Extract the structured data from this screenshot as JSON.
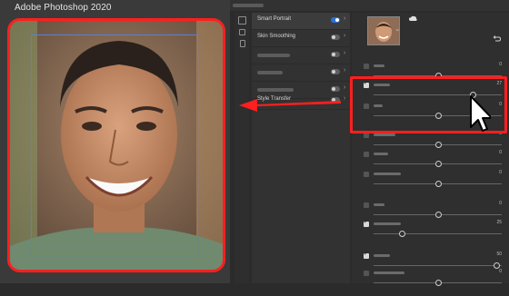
{
  "app": {
    "title": "Adobe Photoshop 2020"
  },
  "colors": {
    "highlight": "#ff1f1f",
    "accent": "#2e6fd8",
    "tracker": "#5b7fd6"
  },
  "filters": {
    "items": [
      {
        "label": "Smart Portrait",
        "enabled": true,
        "active": true
      },
      {
        "label": "Skin Smoothing",
        "enabled": false
      },
      {
        "label": "",
        "enabled": false
      },
      {
        "label": "",
        "enabled": false
      },
      {
        "label": "",
        "enabled": false
      },
      {
        "label": "Style Transfer",
        "enabled": false
      }
    ]
  },
  "icons": {
    "cloud": "cloud-icon",
    "undo": "reset-icon",
    "cursor": "mouse-pointer-icon",
    "arrow": "red-arrow-icon"
  },
  "sliders": [
    {
      "checked": false,
      "value": "0",
      "level": 0.5
    },
    {
      "checked": true,
      "value": "27",
      "level": 0.77
    },
    {
      "checked": false,
      "value": "0",
      "level": 0.5
    },
    {
      "checked": false,
      "value": "0",
      "level": 0.5
    },
    {
      "checked": false,
      "value": "0",
      "level": 0.5
    },
    {
      "checked": false,
      "value": "0",
      "level": 0.5
    },
    {
      "checked": false,
      "value": "0",
      "level": 0.5
    },
    {
      "checked": true,
      "value": "25",
      "level": 0.22
    },
    {
      "checked": true,
      "value": "50",
      "level": 0.96
    },
    {
      "checked": false,
      "value": "0",
      "level": 0.5
    }
  ]
}
